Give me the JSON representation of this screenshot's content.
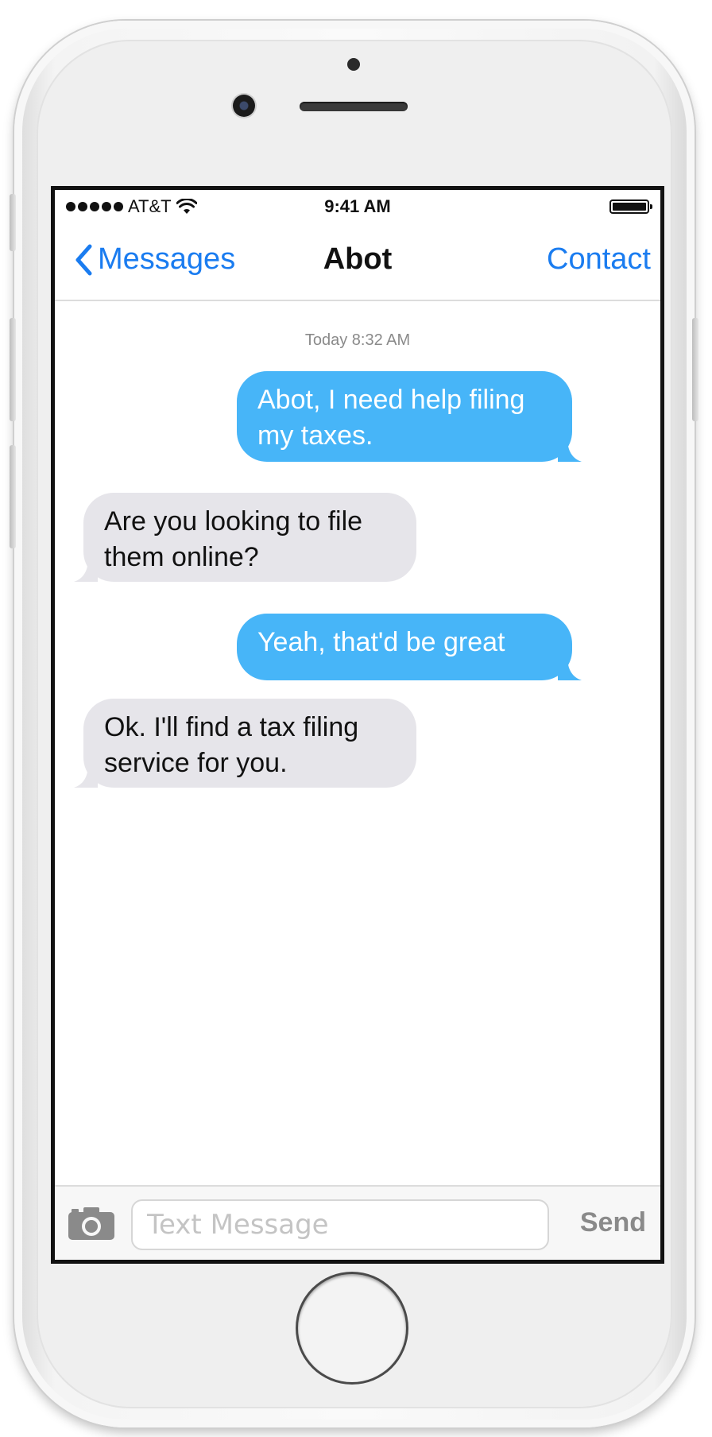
{
  "status_bar": {
    "carrier": "AT&T",
    "time": "9:41 AM"
  },
  "nav": {
    "back_label": "Messages",
    "title": "Abot",
    "right_label": "Contact"
  },
  "conversation": {
    "timestamp": "Today 8:32 AM",
    "messages": [
      {
        "sender": "me",
        "text": "Abot, I need help filing my taxes."
      },
      {
        "sender": "abot",
        "text": "Are you looking to file them online?"
      },
      {
        "sender": "me",
        "text": "Yeah, that'd be great"
      },
      {
        "sender": "abot",
        "text": "Ok. I'll find a tax filing service for you."
      }
    ]
  },
  "composer": {
    "placeholder": "Text Message",
    "send_label": "Send"
  },
  "colors": {
    "accent": "#1a7cf0",
    "sent_bubble": "#47b5f8",
    "received_bubble": "#e6e5ea"
  },
  "icons": [
    "wifi-icon",
    "battery-icon",
    "chevron-left-icon",
    "camera-icon"
  ]
}
